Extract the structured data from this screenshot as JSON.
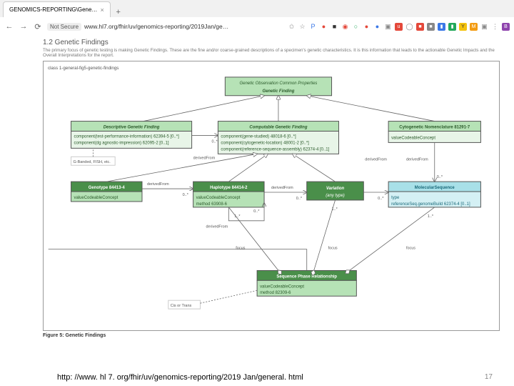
{
  "browser": {
    "tab_title": "GENOMICS-REPORTING\\Gene…",
    "not_secure": "Not Secure",
    "url": "www.hl7.org/fhir/uv/genomics-reporting/2019Jan/ge…"
  },
  "section": {
    "number_title": "1.2 Genetic Findings",
    "desc": "The primary focus of genetic testing is making Genetic Findings. These are the fine and/or coarse-grained descriptions of a specimen's genetic characteristics. It is this information that leads to the actionable Genetic Impacts and the Overall Interpretations for the report."
  },
  "group_label": "class 1-general-fig5-genetic-findings",
  "root": {
    "head1": "Genetic Observation Common Properties",
    "head2": "Genetic Finding"
  },
  "descriptive": {
    "title": "Descriptive Genetic Finding",
    "l1": "component(test-performance-information) 62394-5 [0..*]",
    "l2": "component(dg agnostic-impression) 62095-2 [0..1]",
    "note": "G-Banded, FISH, etc."
  },
  "computable": {
    "title": "Computable Genetic Finding",
    "l1": "component(gene-studied) 48018-6 [0..*]",
    "l2": "component(cytogenetic-location) 48001-2 [0..*]",
    "l3": "component(reference-sequence-assembly) 62374-4 [0..1]"
  },
  "cytonomen": {
    "title": "Cytogenetic Nomenclature 81291-7",
    "l1": "valueCodeableConcept"
  },
  "genotype": {
    "title": "Genotype 84413-4",
    "l1": "valueCodeableConcept"
  },
  "haplotype": {
    "title": "Haplotype 84414-2",
    "l1": "valueCodeableConcept",
    "l2": "method 63908-6"
  },
  "variation": {
    "title": "Variation",
    "sub": "(any type)"
  },
  "molseq": {
    "title": "MolecularSequence",
    "l1": "type",
    "l2": "referenceSeq.genomeBuild 62374-4 [0..1]"
  },
  "seqphase": {
    "title": "Sequence Phase Relationship",
    "l1": "valueCodeableConcept",
    "l2": "method 82309-6",
    "note": "Cis or Trans"
  },
  "labels": {
    "derivedFrom": "derivedFrom",
    "focus": "focus",
    "zero_star": "0..*",
    "one_star": "1..*"
  },
  "figure_caption": "Figure 5: Genetic Findings",
  "footer_url": "http: //www. hl 7. org/fhir/uv/genomics-reporting/2019 Jan/general. html",
  "page_number": "17"
}
